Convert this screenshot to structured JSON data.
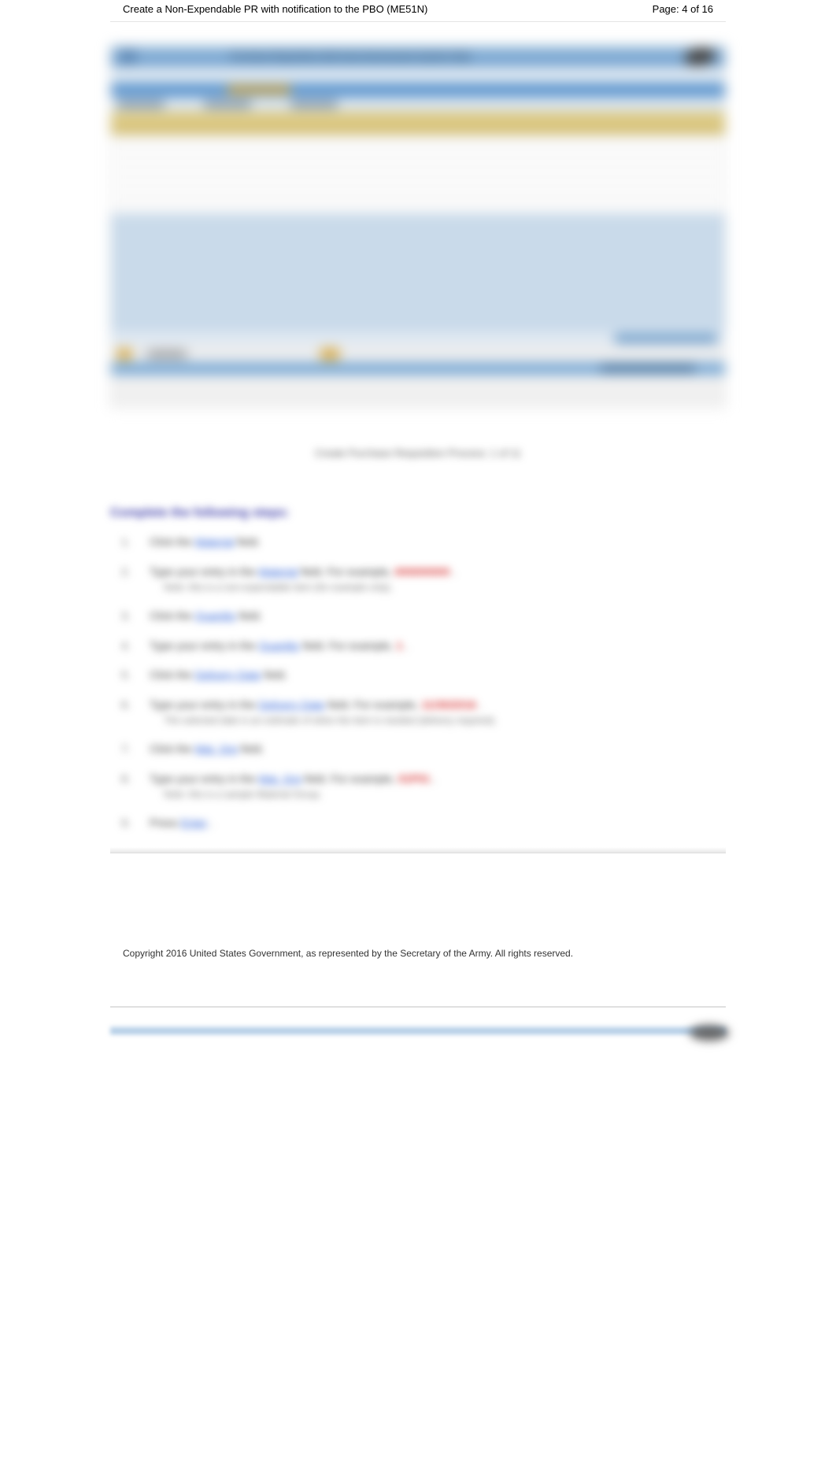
{
  "header": {
    "title": "Create a Non-Expendable PR with notification to the PBO (ME51N)",
    "page_label": "Page: 4 of 16"
  },
  "screenshot": {
    "top_text": "Purchase Requisition   Edit   Goto   Environment   System   Help",
    "title_text": "Create Purchase Requisition"
  },
  "caption": "Create Purchase Requisition Process: 1 of 11",
  "section_heading": "Complete the following steps:",
  "steps": [
    {
      "num": "1.",
      "pre": "Click the ",
      "link": "Material",
      "post": " field."
    },
    {
      "num": "2.",
      "pre": "Type your entry in the ",
      "link": "Material",
      "post": " field. For example, ",
      "red": "000000000",
      "tail": ".",
      "sub": "Note: this is a non-expendable item (for example only)."
    },
    {
      "num": "3.",
      "pre": "Click the ",
      "link": "Quantity",
      "post": " field."
    },
    {
      "num": "4.",
      "pre": "Type your entry in the ",
      "link": "Quantity",
      "post": " field. For example, ",
      "red": "1",
      "tail": "."
    },
    {
      "num": "5.",
      "pre": "Click the ",
      "link": "Delivery Date",
      "post": " field."
    },
    {
      "num": "6.",
      "pre": "Type your entry in the ",
      "link": "Delivery Date",
      "post": " field. For example, ",
      "red": "11/30/2016",
      "tail": ".",
      "sub": "The selected date is an estimate of when the item is needed (delivery required)."
    },
    {
      "num": "7.",
      "pre": "Click the ",
      "link": "Mat. Grp",
      "post": " field."
    },
    {
      "num": "8.",
      "pre": "Type your entry in the ",
      "link": "Mat. Grp",
      "post": " field. For example, ",
      "red": "01P01",
      "tail": ".",
      "sub": "Note: this is a sample Material Group."
    },
    {
      "num": "9.",
      "pre": "Press ",
      "link": "Enter",
      "post": "."
    }
  ],
  "copyright": "Copyright 2016 United States Government, as represented by the Secretary of the Army. All rights reserved."
}
